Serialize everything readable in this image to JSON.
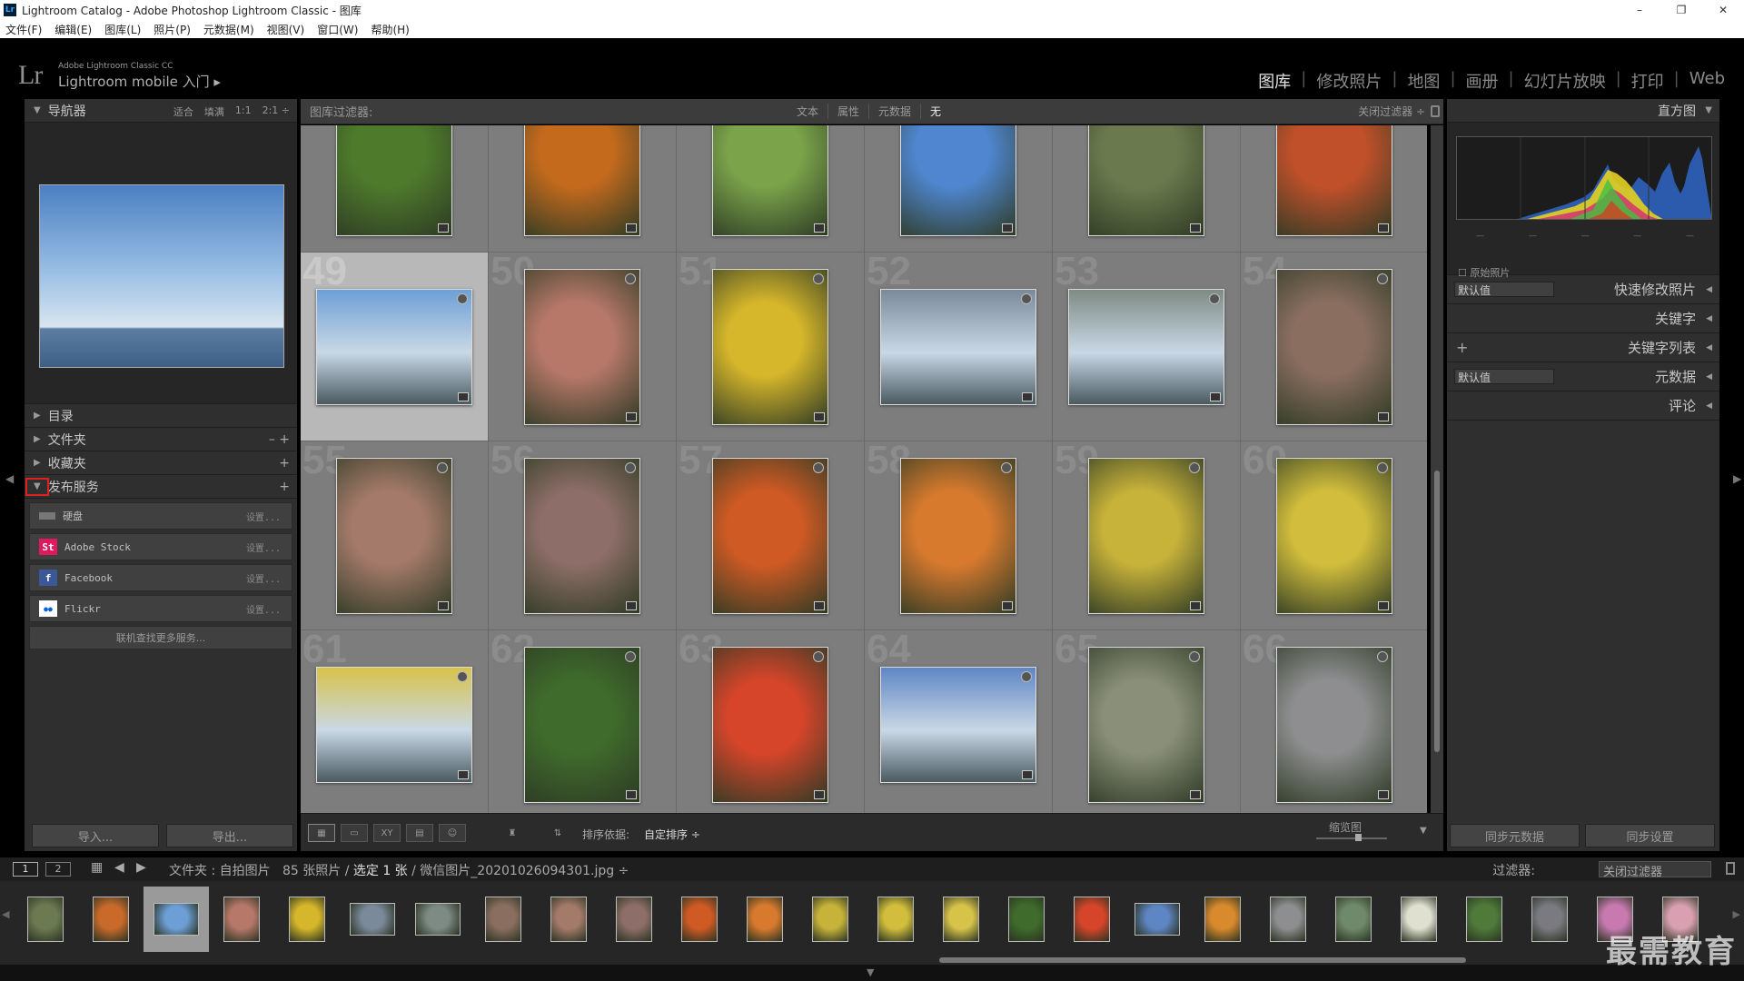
{
  "window": {
    "title": "Lightroom Catalog - Adobe Photoshop Lightroom Classic - 图库",
    "logo": "Lr",
    "controls": [
      "–",
      "❐",
      "✕"
    ]
  },
  "menu": [
    "文件(F)",
    "编辑(E)",
    "图库(L)",
    "照片(P)",
    "元数据(M)",
    "视图(V)",
    "窗口(W)",
    "帮助(H)"
  ],
  "identity": {
    "logo": "Lr",
    "product": "Adobe Lightroom Classic CC",
    "tagline": "Lightroom mobile 入门 ▸"
  },
  "modules": [
    "图库",
    "修改照片",
    "地图",
    "画册",
    "幻灯片放映",
    "打印",
    "Web"
  ],
  "navigator": {
    "title": "导航器",
    "options": [
      "适合",
      "填满",
      "1:1",
      "2:1 ÷"
    ]
  },
  "left_sections": [
    {
      "label": "目录",
      "action": ""
    },
    {
      "label": "文件夹",
      "action": "–  +"
    },
    {
      "label": "收藏夹",
      "action": "+"
    },
    {
      "label": "发布服务",
      "action": "+"
    }
  ],
  "publish_services": [
    {
      "name": "硬盘",
      "settings": "设置...",
      "icon": "hdd-icon",
      "icon_text": "",
      "color": "#888888"
    },
    {
      "name": "Adobe Stock",
      "settings": "设置...",
      "icon": "adobe-stock-icon",
      "icon_text": "St",
      "color": "#e0195e"
    },
    {
      "name": "Facebook",
      "settings": "设置...",
      "icon": "facebook-icon",
      "icon_text": "f",
      "color": "#3b5998"
    },
    {
      "name": "Flickr",
      "settings": "设置...",
      "icon": "flickr-icon",
      "icon_text": "●●",
      "color": "#0063dc"
    }
  ],
  "more_services": "联机查找更多服务...",
  "import_label": "导入...",
  "export_label": "导出...",
  "filter_bar": {
    "label": "图库过滤器:",
    "tabs": [
      "文本",
      "属性",
      "元数据",
      "无"
    ],
    "active_tab": "无",
    "preset": "关闭过滤器 ÷"
  },
  "grid_cells": [
    {
      "n": "",
      "o": "p",
      "c": "#4e7a2c"
    },
    {
      "n": "",
      "o": "p",
      "c": "#c46a1d"
    },
    {
      "n": "",
      "o": "p",
      "c": "#7aa34a"
    },
    {
      "n": "",
      "o": "p",
      "c": "#4f86cf"
    },
    {
      "n": "",
      "o": "p",
      "c": "#6b7a4e"
    },
    {
      "n": "",
      "o": "p",
      "c": "#c0502a"
    },
    {
      "n": "49",
      "o": "l",
      "c": "#6d9fd6",
      "sel": true
    },
    {
      "n": "50",
      "o": "p",
      "c": "#b7786a"
    },
    {
      "n": "51",
      "o": "p",
      "c": "#d6b62a"
    },
    {
      "n": "52",
      "o": "l",
      "c": "#7b8a9a"
    },
    {
      "n": "53",
      "o": "l",
      "c": "#7e8b84"
    },
    {
      "n": "54",
      "o": "p",
      "c": "#8a6e60"
    },
    {
      "n": "55",
      "o": "p",
      "c": "#a47a6a"
    },
    {
      "n": "56",
      "o": "p",
      "c": "#8d6e68"
    },
    {
      "n": "57",
      "o": "p",
      "c": "#d05a24"
    },
    {
      "n": "58",
      "o": "p",
      "c": "#d87a2e"
    },
    {
      "n": "59",
      "o": "p",
      "c": "#c8b33a"
    },
    {
      "n": "60",
      "o": "p",
      "c": "#d2be3c"
    },
    {
      "n": "61",
      "o": "l",
      "c": "#d7c24a"
    },
    {
      "n": "62",
      "o": "p",
      "c": "#3f6b2c"
    },
    {
      "n": "63",
      "o": "p",
      "c": "#d6452a"
    },
    {
      "n": "64",
      "o": "l",
      "c": "#5f86c4"
    },
    {
      "n": "65",
      "o": "p",
      "c": "#8a8f7a"
    },
    {
      "n": "66",
      "o": "p",
      "c": "#8e8e90"
    }
  ],
  "toolbar": {
    "sort_label": "排序依据:",
    "sort_value": "自定排序 ÷",
    "zoom_label": "缩览图",
    "zoom": 0.55
  },
  "histogram": {
    "title": "直方图",
    "original_photo": "原始照片"
  },
  "right_sections": [
    {
      "label": "快速修改照片",
      "select": "默认值",
      "plus": false
    },
    {
      "label": "关键字",
      "select": "",
      "plus": false
    },
    {
      "label": "关键字列表",
      "select": "",
      "plus": true
    },
    {
      "label": "元数据",
      "select": "默认值",
      "plus": false
    },
    {
      "label": "评论",
      "select": "",
      "plus": false
    }
  ],
  "sync_metadata": "同步元数据",
  "sync_settings": "同步设置",
  "secondary": {
    "view1": "1",
    "view2": "2",
    "path_prefix": "文件夹 : 自拍图片",
    "count": "85 张照片 /",
    "selected": "选定 1 张",
    "file": "/ 微信图片_20201026094301.jpg ÷",
    "filter_label": "过滤器:",
    "filter_value": "关闭过滤器"
  },
  "filmstrip": [
    "#6c7a52",
    "#c96a2a",
    "#6d9fd6",
    "#b7786a",
    "#d6b62a",
    "#7b8a9a",
    "#7e8b84",
    "#8a6e60",
    "#a47a6a",
    "#8d6e68",
    "#d05a24",
    "#d87a2e",
    "#c8b33a",
    "#d2be3c",
    "#d7c24a",
    "#3f6b2c",
    "#d6452a",
    "#5f86c4",
    "#d98a2c",
    "#8e8e90",
    "#6f8a6a",
    "#e0e0d0",
    "#4f7a3a",
    "#7a7a80",
    "#c87ab0",
    "#d8a0b0"
  ],
  "filmstrip_selected": 2,
  "watermark": "最需教育"
}
